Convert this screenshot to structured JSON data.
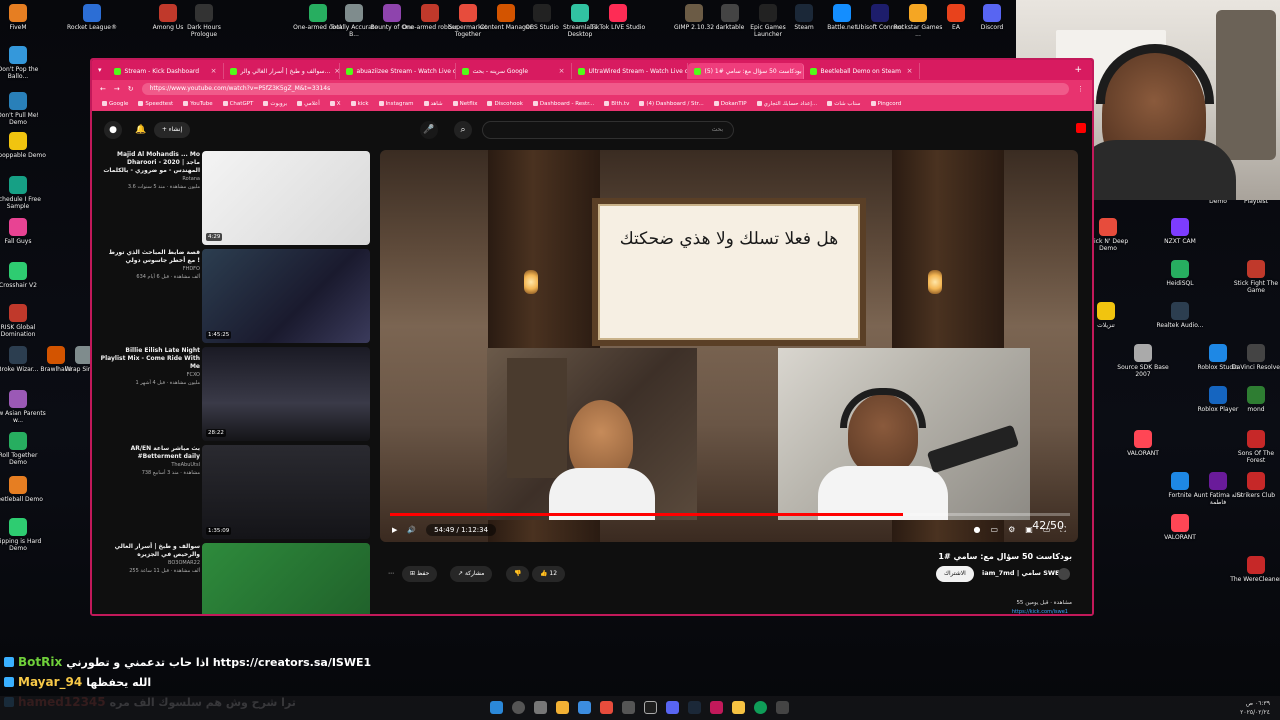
{
  "desktop_icons_top": [
    {
      "label": "FiveM",
      "color": "#e67e22"
    },
    {
      "label": "Rocket League®",
      "color": "#2c6ed5"
    },
    {
      "label": "Among Us",
      "color": "#c0392b"
    },
    {
      "label": "Dark Hours Prologue",
      "color": "#333333"
    },
    {
      "label": "One-armed cook",
      "color": "#27ae60"
    },
    {
      "label": "Totally Accurate B...",
      "color": "#7f8c8d"
    },
    {
      "label": "Bounty of One",
      "color": "#8e44ad"
    },
    {
      "label": "One-armed robber",
      "color": "#c0392b"
    },
    {
      "label": "Supermarket Together",
      "color": "#e74c3c"
    },
    {
      "label": "Content Manager",
      "color": "#d35400"
    },
    {
      "label": "OBS Studio",
      "color": "#222222"
    },
    {
      "label": "Streamlabs Desktop",
      "color": "#31c3a2"
    },
    {
      "label": "TikTok LIVE Studio",
      "color": "#fe2c55"
    },
    {
      "label": "GIMP 2.10.32",
      "color": "#6b5b45"
    },
    {
      "label": "darktable",
      "color": "#444444"
    },
    {
      "label": "Epic Games Launcher",
      "color": "#222222"
    },
    {
      "label": "Steam",
      "color": "#1b2838"
    },
    {
      "label": "Battle.net",
      "color": "#148eff"
    },
    {
      "label": "Ubisoft Connect",
      "color": "#1d1d6b"
    },
    {
      "label": "Rockstar Games ...",
      "color": "#f5a623"
    },
    {
      "label": "EA",
      "color": "#e8421c"
    },
    {
      "label": "Discord",
      "color": "#5865f2"
    }
  ],
  "desktop_icons_left": [
    {
      "label": "Don't Pop the Ballo...",
      "color": "#3498db"
    },
    {
      "label": "Don't Pull Me! Demo",
      "color": "#2980b9"
    },
    {
      "label": "Unpoppable Demo",
      "color": "#f1c40f"
    },
    {
      "label": "Schedule I Free Sample",
      "color": "#16a085"
    },
    {
      "label": "Fall Guys",
      "color": "#e84393"
    },
    {
      "label": "Crosshair V2",
      "color": "#2ecc71"
    },
    {
      "label": "RISK Global Domination",
      "color": "#c0392b"
    },
    {
      "label": "Broke Wizar...",
      "color": "#2c3e50"
    },
    {
      "label": "Brawlhalla",
      "color": "#d35400"
    },
    {
      "label": "Wrap Simu...",
      "color": "#7f8c8d"
    },
    {
      "label": "How Asian Parents w...",
      "color": "#9b59b6"
    },
    {
      "label": "Roll Together Demo",
      "color": "#27ae60"
    },
    {
      "label": "Beetleball Demo",
      "color": "#e67e22"
    },
    {
      "label": "Flipping is Hard Demo",
      "color": "#2ecc71"
    }
  ],
  "desktop_icons_right": [
    {
      "label": "Demo",
      "color": "#555555"
    },
    {
      "label": "Playtest",
      "color": "#666666"
    },
    {
      "label": "Stick N' Deep Demo",
      "color": "#e74c3c"
    },
    {
      "label": "NZXT CAM",
      "color": "#7d3cff"
    },
    {
      "label": "HeidiSQL",
      "color": "#27ae60"
    },
    {
      "label": "Stick Fight The Game",
      "color": "#c0392b"
    },
    {
      "label": "تنزيلات",
      "color": "#f1c40f"
    },
    {
      "label": "Realtek Audio...",
      "color": "#2c3e50"
    },
    {
      "label": "Source SDK Base 2007",
      "color": "#aaaaaa"
    },
    {
      "label": "Roblox Studio",
      "color": "#1e88e5"
    },
    {
      "label": "DaVinci Resolve",
      "color": "#444444"
    },
    {
      "label": "Roblox Player",
      "color": "#1565c0"
    },
    {
      "label": "mond",
      "color": "#2e7d32"
    },
    {
      "label": "VALORANT",
      "color": "#ff4655"
    },
    {
      "label": "Sons Of The Forest",
      "color": "#c62828"
    },
    {
      "label": "Fortnite",
      "color": "#1e88e5"
    },
    {
      "label": "Aunt Fatima خالة فاطمة",
      "color": "#6a1b9a"
    },
    {
      "label": "Strikers Club",
      "color": "#c62828"
    },
    {
      "label": "VALORANT",
      "color": "#ff4655"
    },
    {
      "label": "The WereCleaner",
      "color": "#c62828"
    }
  ],
  "browser": {
    "tabs": [
      {
        "label": "Stream - Kick Dashboard",
        "active": false
      },
      {
        "label": "سوالف و طبخ | أسرار الغالي والر...",
        "active": false
      },
      {
        "label": "abuaziizee Stream - Watch Live o...",
        "active": false
      },
      {
        "label": "سرينه - بحث Google",
        "active": false
      },
      {
        "label": "UltraWired Stream - Watch Live o...",
        "active": false
      },
      {
        "label": "(5) بودكاست 50 سؤال مع: سامي #1",
        "active": true
      },
      {
        "label": "Beetleball Demo on Steam",
        "active": false
      }
    ],
    "url": "https://www.youtube.com/watch?v=P5fZ3K5gZ_M&t=3314s",
    "bookmarks": [
      "Google",
      "Speedtest",
      "YouTube",
      "ChatGPT",
      "بروبوت",
      "أعلامي",
      "X",
      "kick",
      "Instagram",
      "شاهد",
      "Netflix",
      "Discohook",
      "Dashboard - Restr...",
      "Blth.tv",
      "(4) Dashboard / Str...",
      "DokanTIP",
      "إعداد حسابك التجاري...",
      "سناب شات",
      "Pingcord"
    ]
  },
  "youtube": {
    "search_placeholder": "بحث",
    "create_label": "إنشاء",
    "recommendations": [
      {
        "title": "Majid Al Mohandis ... Mo Dharoori - 2020 | ماجد المهندس - مو ضروري - بالكلمات",
        "channel": "Rotana",
        "meta": "3.6 مليون مشاهدة · منذ 5 سنوات",
        "duration": "4:29"
      },
      {
        "title": "قصة ضابط المباحث الذي تورط مع أخطر جاسوس دولي !",
        "channel": "FHDFO",
        "meta": "634 ألف مشاهدة · قبل 6 أيام",
        "duration": "1:45:25"
      },
      {
        "title": "Billie Eilish Late Night Playlist Mix - Come Ride With Me",
        "channel": "FCXO",
        "meta": "1 مليون مشاهدة · قبل 4 أشهر",
        "duration": "28:22"
      },
      {
        "title": "AR/EN بث مباشر ساعة #Betterment daily",
        "channel": "TheAbuUtsl",
        "meta": "738 مشاهدة · منذ 3 أسابيع",
        "duration": "1:35:09"
      },
      {
        "title": "سوالف و طبخ | أسرار الغالي والرخيص في الجزيره",
        "channel": "BO3OMAR22",
        "meta": "255 ألف مشاهدة · قبل 11 ساعة",
        "duration": ""
      }
    ],
    "player": {
      "question": "هل فعلا تسلك ولا هذي ضحكتك",
      "counter": "42/50",
      "time": "54:49 / 1:12:34",
      "progress": 0.755
    },
    "video_title": "بودكاست 50 سؤال مع: سامي #1",
    "channel_name": "iam_7md | سامي SWE",
    "subscribe_label": "الاشتراك",
    "likes": "12",
    "share_label": "مشاركة",
    "save_label": "حفظ",
    "views": "55 مشاهدة · قبل يومين",
    "desc_link": "https://kick.com/iswe1"
  },
  "chat": [
    {
      "user": "BotRix",
      "message": "اذا حاب تدعمني و تطورني https://creators.sa/ISWE1",
      "color": "#6fcf3a"
    },
    {
      "user": "Mayar_94",
      "message": "الله يحفظها",
      "color": "#f7c948"
    },
    {
      "user": "hamed12345",
      "message": "ترا شرح وش هم سلسوك الف مره",
      "color": "#e74c3c"
    }
  ],
  "taskbar": {
    "clock": "٠٦:٣٩ ص",
    "date": "٢٠٢٥/٠٢/٢٤"
  },
  "colors": {
    "accent": "#d81b60",
    "youtube_red": "#ff0000",
    "kick_green": "#53fc18"
  }
}
